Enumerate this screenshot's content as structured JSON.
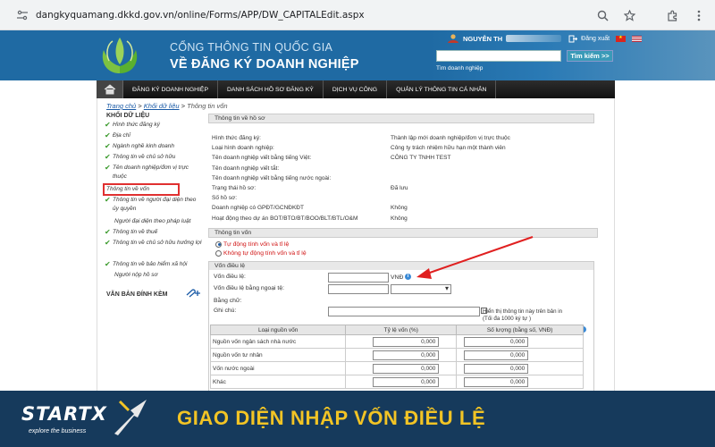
{
  "browser": {
    "url": "dangkyquamang.dkkd.gov.vn/online/Forms/APP/DW_CAPITALEdit.aspx"
  },
  "header": {
    "title_line1": "CỔNG THÔNG TIN QUỐC GIA",
    "title_line2": "VỀ ĐĂNG KÝ DOANH NGHIỆP",
    "user_prefix": "NGUYỄN TH",
    "logout": "Đăng xuất",
    "search_button": "Tìm kiếm >>",
    "search_link": "Tìm doanh nghiệp"
  },
  "nav": {
    "items": [
      "ĐĂNG KÝ DOANH NGHIỆP",
      "DANH SÁCH HỒ SƠ ĐĂNG KÝ",
      "DỊCH VỤ CÔNG",
      "QUẢN LÝ THÔNG TIN CÁ NHÂN"
    ]
  },
  "breadcrumb": {
    "home": "Trang chủ",
    "sep": " > ",
    "section": "Khối dữ liệu",
    "current": "Thông tin vốn"
  },
  "sidebar": {
    "title": "KHỐI DỮ LIỆU",
    "items": [
      {
        "label": "Hình thức đăng ký",
        "checked": true
      },
      {
        "label": "Địa chỉ",
        "checked": true
      },
      {
        "label": "Ngành nghề kinh doanh",
        "checked": true
      },
      {
        "label": "Thông tin về chủ sở hữu",
        "checked": true
      },
      {
        "label": "Tên doanh nghiệp/đơn vị trực thuộc",
        "checked": true
      },
      {
        "label": "Thông tin về vốn",
        "checked": false,
        "active": true
      },
      {
        "label": "Thông tin về người đại diện theo ủy quyền",
        "checked": true
      },
      {
        "label": "Người đại diện theo pháp luật",
        "checked": false
      },
      {
        "label": "Thông tin về thuế",
        "checked": true
      },
      {
        "label": "Thông tin về chủ sở hữu hưởng lợi",
        "checked": true
      },
      {
        "label": "Thông tin về bảo hiểm xã hội",
        "checked": true
      },
      {
        "label": "Người nộp hồ sơ",
        "checked": false
      }
    ],
    "attachments_title": "VĂN BẢN ĐÍNH KÈM"
  },
  "info": {
    "header": "Thông tin về hồ sơ",
    "rows": [
      {
        "key": "Hình thức đăng ký:",
        "value": "Thành lập mới doanh nghiệp/đơn vị trực thuộc"
      },
      {
        "key": "Loại hình doanh nghiệp:",
        "value": "Công ty trách nhiệm hữu hạn một thành viên"
      },
      {
        "key": "Tên doanh nghiệp viết bằng tiếng Việt:",
        "value": "CÔNG TY TNHH TEST"
      },
      {
        "key": "Tên doanh nghiệp viết tắt:",
        "value": ""
      },
      {
        "key": "Tên doanh nghiệp viết bằng tiếng nước ngoài:",
        "value": ""
      },
      {
        "key": "Trạng thái hồ sơ:",
        "value": "Đã lưu"
      },
      {
        "key": "Số hồ sơ:",
        "value": ""
      },
      {
        "key": "Doanh nghiệp có GPĐT/GCNĐKĐT",
        "value": "Không"
      },
      {
        "key": "Hoạt động theo dự án BOT/BTO/BT/BOO/BLT/BTL/O&M",
        "value": "Không"
      }
    ]
  },
  "capital": {
    "header": "Thông tin vốn",
    "radio_auto": "Tự động tính vốn và tỉ lệ",
    "radio_manual": "Không tự động tính vốn và tỉ lệ",
    "charter_header": "Vốn điều lệ",
    "charter_label": "Vốn điều lệ:",
    "currency": "VNĐ",
    "foreign_label": "Vốn điều lệ bằng ngoại tệ:",
    "words_label": "Bằng chữ:",
    "note_label": "Ghi chú:",
    "show_info_text": "Hiển thị thông tin này trên bản in (Tối đa 1000 ký tự )"
  },
  "sources": {
    "headers": [
      "Loại nguồn vốn",
      "Tỷ lệ vốn (%)",
      "Số lượng (bằng số, VNĐ)"
    ],
    "rows": [
      {
        "name": "Nguồn vốn ngân sách nhà nước",
        "ratio": "0,000",
        "amount": "0,000"
      },
      {
        "name": "Nguồn vốn tư nhân",
        "ratio": "0,000",
        "amount": "0,000"
      },
      {
        "name": "Vốn nước ngoài",
        "ratio": "0,000",
        "amount": "0,000"
      },
      {
        "name": "Khác",
        "ratio": "0,000",
        "amount": "0,000"
      }
    ]
  },
  "banner": {
    "logo_text": "STARTX",
    "logo_sub": "explore the business",
    "title": "GIAO DIỆN NHẬP VỐN ĐIỀU LỆ"
  },
  "colors": {
    "header_blue": "#1f6aa3",
    "banner_navy": "#163a5c",
    "banner_yellow": "#f2c425",
    "highlight_red": "#e03030"
  }
}
